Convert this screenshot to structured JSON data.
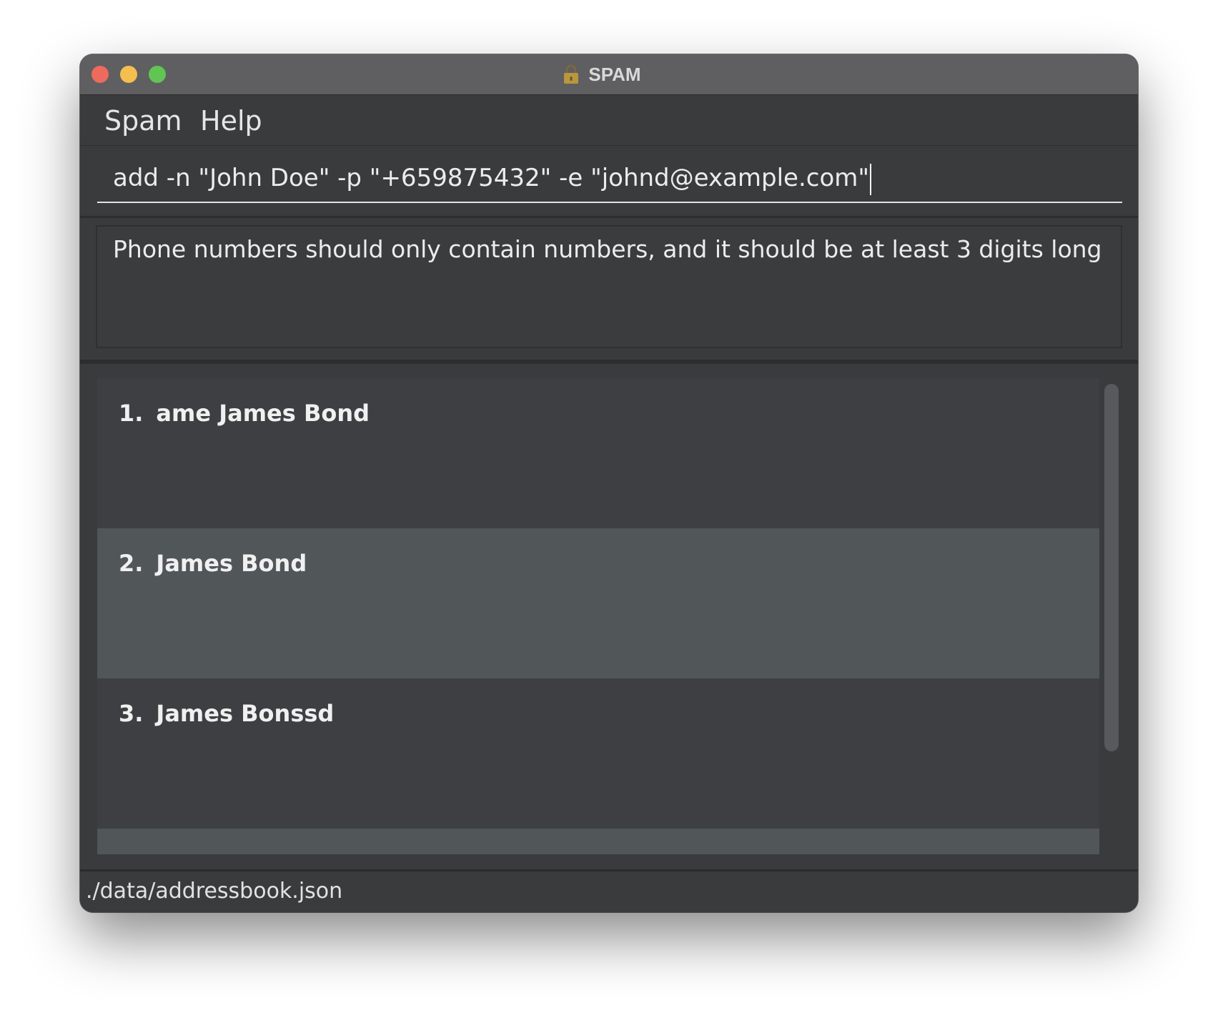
{
  "window": {
    "title": "SPAM",
    "title_icon": "lock-icon"
  },
  "menu": {
    "items": [
      {
        "label": "Spam"
      },
      {
        "label": "Help"
      }
    ]
  },
  "command": {
    "value": "add -n \"John Doe\" -p \"+659875432\" -e \"johnd@example.com\""
  },
  "result": {
    "message": "Phone numbers should only contain numbers, and it should be at least 3 digits long"
  },
  "person_list": {
    "items": [
      {
        "index": "1.",
        "name": "ame James Bond"
      },
      {
        "index": "2.",
        "name": "James Bond"
      },
      {
        "index": "3.",
        "name": "James Bonssd"
      }
    ]
  },
  "status": {
    "file_path": "./data/addressbook.json"
  },
  "colors": {
    "background": "#3a3b3d",
    "titlebar": "#5f5f61",
    "selected_card": "#515659",
    "card": "#3e3f42",
    "close": "#ed6a5e",
    "minimize": "#f4bf4f",
    "maximize": "#61c554"
  }
}
